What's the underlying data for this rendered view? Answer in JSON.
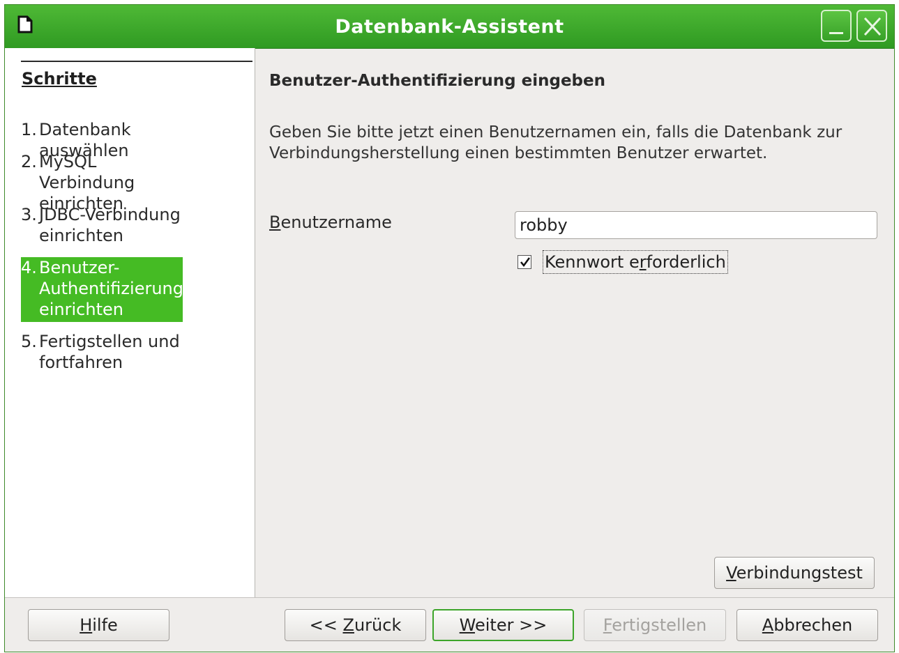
{
  "window": {
    "title": "Datenbank-Assistent",
    "accent_color": "#3da52a"
  },
  "sidebar": {
    "heading": "Schritte",
    "steps": [
      {
        "num": "1.",
        "label": "Datenbank auswählen"
      },
      {
        "num": "2.",
        "label": "MySQL Verbindung einrichten"
      },
      {
        "num": "3.",
        "label": "JDBC-Verbindung einrichten"
      },
      {
        "num": "4.",
        "label": "Benutzer-Authentifizierung einrichten"
      },
      {
        "num": "5.",
        "label": "Fertigstellen und fortfahren"
      }
    ],
    "active_step": 4
  },
  "main": {
    "title": "Benutzer-Authentifizierung eingeben",
    "description": "Geben Sie bitte jetzt einen Benutzernamen ein, falls die Datenbank zur Verbindungsherstellung einen bestimmten Benutzer erwartet.",
    "username_label_first": "B",
    "username_label_rest": "enutzername",
    "username_value": "robby",
    "password_required_pre": "Kennwort e",
    "password_required_u": "r",
    "password_required_post": "forderlich",
    "password_required_checked": true,
    "conn_test_u": "V",
    "conn_test_rest": "erbindungstest"
  },
  "footer": {
    "help_u": "H",
    "help_rest": "ilfe",
    "back_pre": "<< ",
    "back_u": "Z",
    "back_rest": "urück",
    "next_u": "W",
    "next_rest": "eiter >>",
    "finish_u": "F",
    "finish_rest": "ertigstellen",
    "cancel_u": "A",
    "cancel_rest": "bbrechen"
  }
}
